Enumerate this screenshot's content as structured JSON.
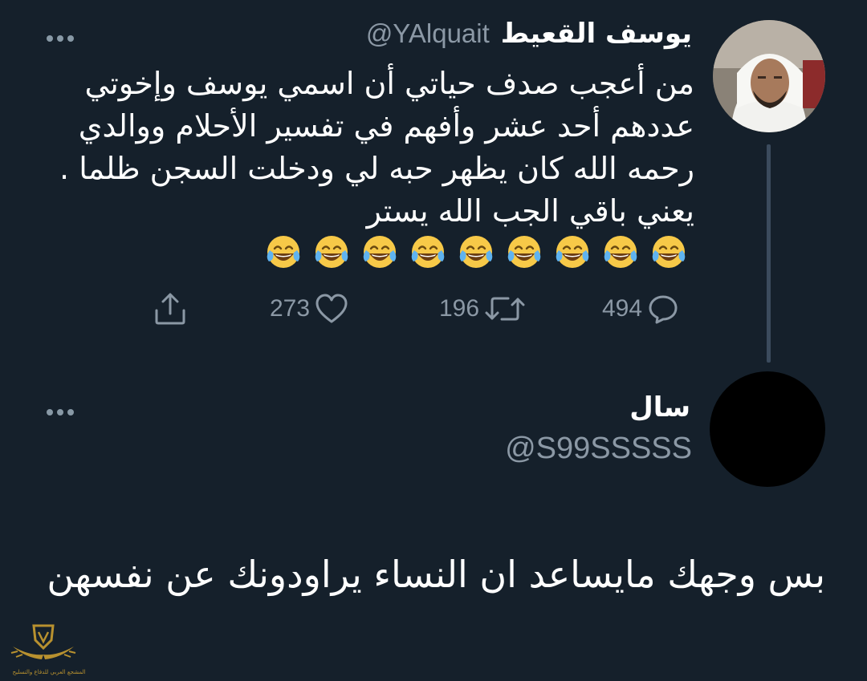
{
  "tweet": {
    "author_name": "يوسف القعيط",
    "author_handle": "@YAlquait",
    "text_lines": [
      "من أعجب صدف حياتي أن اسمي يوسف وإخوتي",
      "عددهم أحد عشر وأفهم في تفسير الأحلام ووالدي",
      "رحمه الله كان يظهر حبه لي ودخلت السجن ظلما .",
      "يعني باقي الجب الله يستر"
    ],
    "emoji_count": 9,
    "emoji_name": "face-with-tears-of-joy",
    "stats": {
      "likes": "273",
      "retweets": "196",
      "replies": "494"
    }
  },
  "reply": {
    "author_name": "سال",
    "author_handle": "@S99SSSSS",
    "text": "بس وجهك مايساعد ان النساء يراودونك عن نفسهن"
  },
  "watermark": {
    "text": "المشجع العربي للدفاع والتسليح"
  },
  "colors": {
    "background": "#15202b",
    "text_primary": "#ffffff",
    "text_secondary": "#8b98a5",
    "thread_line": "#3b4b5d",
    "watermark_gold": "#b8912f"
  }
}
